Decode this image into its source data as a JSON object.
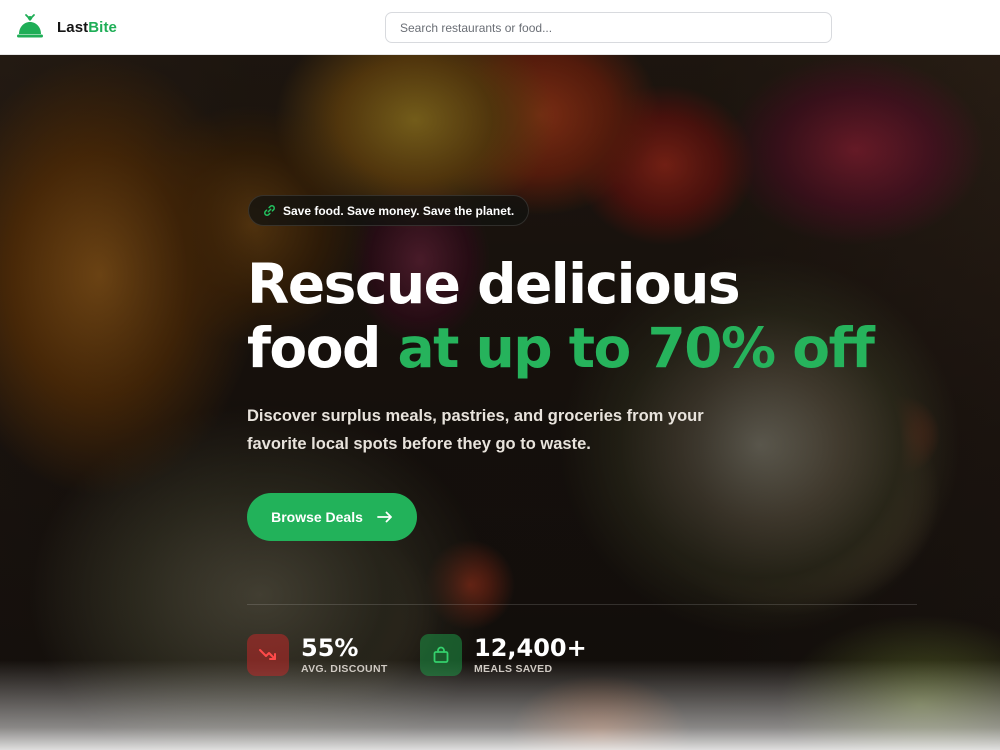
{
  "header": {
    "brand_prefix": "Last",
    "brand_suffix": "Bite",
    "search_placeholder": "Search restaurants or food...",
    "brand_icon": "cloche-icon"
  },
  "hero": {
    "tagline": "Save food. Save money. Save the planet.",
    "tagline_icon": "link-icon",
    "headline_line1": "Rescue delicious",
    "headline_line2_plain": "food ",
    "headline_line2_highlight": "at up to 70% off",
    "subtitle": "Discover surplus meals, pastries, and groceries from your favorite local spots before they go to waste.",
    "cta_label": "Browse Deals",
    "cta_icon": "arrow-right-icon"
  },
  "stats": [
    {
      "value": "55%",
      "label": "AVG. DISCOUNT",
      "icon": "trending-down-icon"
    },
    {
      "value": "12,400+",
      "label": "MEALS SAVED",
      "icon": "shopping-bag-icon"
    }
  ],
  "colors": {
    "accent": "#22b25a",
    "highlight": "#26b35c",
    "header_bg": "#ffffff"
  }
}
